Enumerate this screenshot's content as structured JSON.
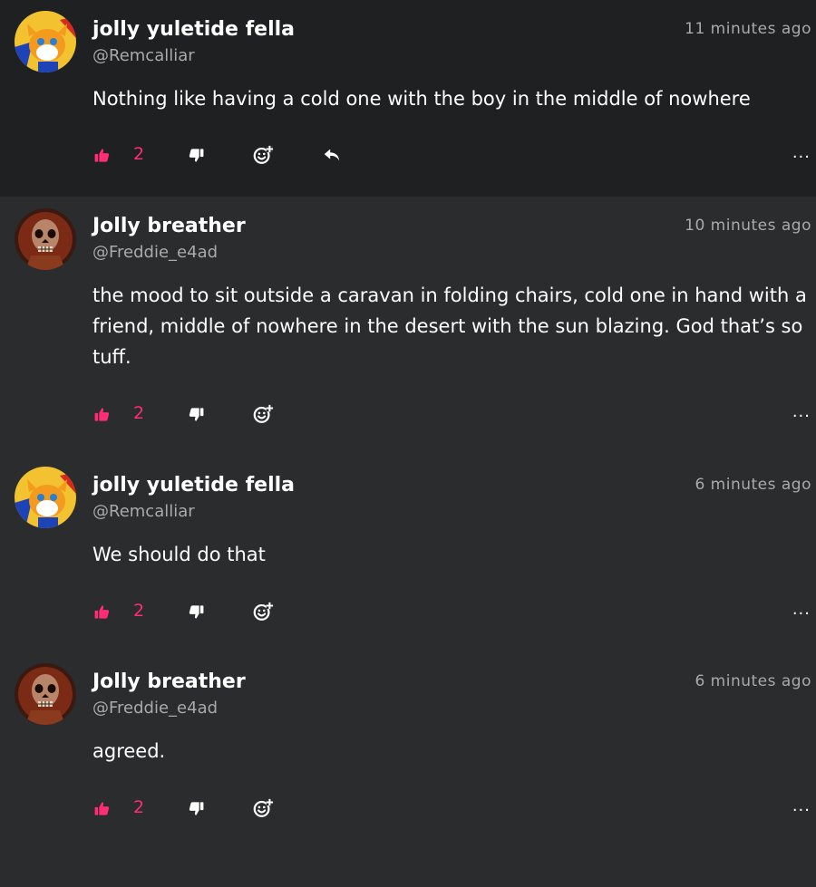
{
  "colors": {
    "background": "#2a2c2d",
    "highlight_background": "#1e2021",
    "accent": "#ff2d73",
    "muted_text": "#a8aaab"
  },
  "comments": [
    {
      "username": "jolly yuletide fella",
      "handle": "@Remcalliar",
      "time": "11 minutes ago",
      "text": "Nothing like having a cold one with the boy in the middle of nowhere",
      "likes": "2",
      "more": "..."
    },
    {
      "username": "Jolly breather",
      "handle": "@Freddie_e4ad",
      "time": "10 minutes ago",
      "text": "the mood to sit outside a caravan in folding chairs, cold one in hand with a friend, middle of nowhere in the desert with the sun blazing. God that’s so tuff.",
      "likes": "2",
      "more": "..."
    },
    {
      "username": "jolly yuletide fella",
      "handle": "@Remcalliar",
      "time": "6 minutes ago",
      "text": "We should do that",
      "likes": "2",
      "more": "..."
    },
    {
      "username": "Jolly breather",
      "handle": "@Freddie_e4ad",
      "time": "6 minutes ago",
      "text": "agreed.",
      "likes": "2",
      "more": "..."
    }
  ],
  "icons": {
    "like": "thumbs-up-icon",
    "dislike": "thumbs-down-icon",
    "react": "add-reaction-icon",
    "reply": "reply-icon",
    "more": "more-options-icon"
  }
}
